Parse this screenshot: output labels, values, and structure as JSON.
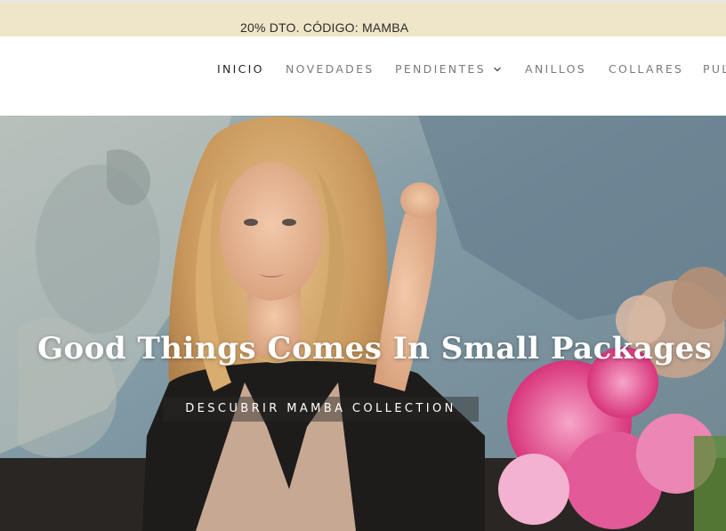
{
  "promo": {
    "text": "20% DTO. CÓDIGO: MAMBA"
  },
  "nav": {
    "items": [
      {
        "label": "INICIO",
        "active": true
      },
      {
        "label": "NOVEDADES"
      },
      {
        "label": "PENDIENTES",
        "has_dropdown": true,
        "icon": "chevron-down-icon"
      },
      {
        "label": "ANILLOS"
      },
      {
        "label": "COLLARES"
      },
      {
        "label": "PUL"
      }
    ]
  },
  "hero": {
    "title": "Good Things Comes In Small Packages",
    "cta_label": "DESCUBRIR MAMBA COLLECTION"
  },
  "colors": {
    "promo_bg": "#efe5c8",
    "nav_active": "#222222",
    "nav_text": "#7a7a7a",
    "hero_text": "#ffffff"
  }
}
